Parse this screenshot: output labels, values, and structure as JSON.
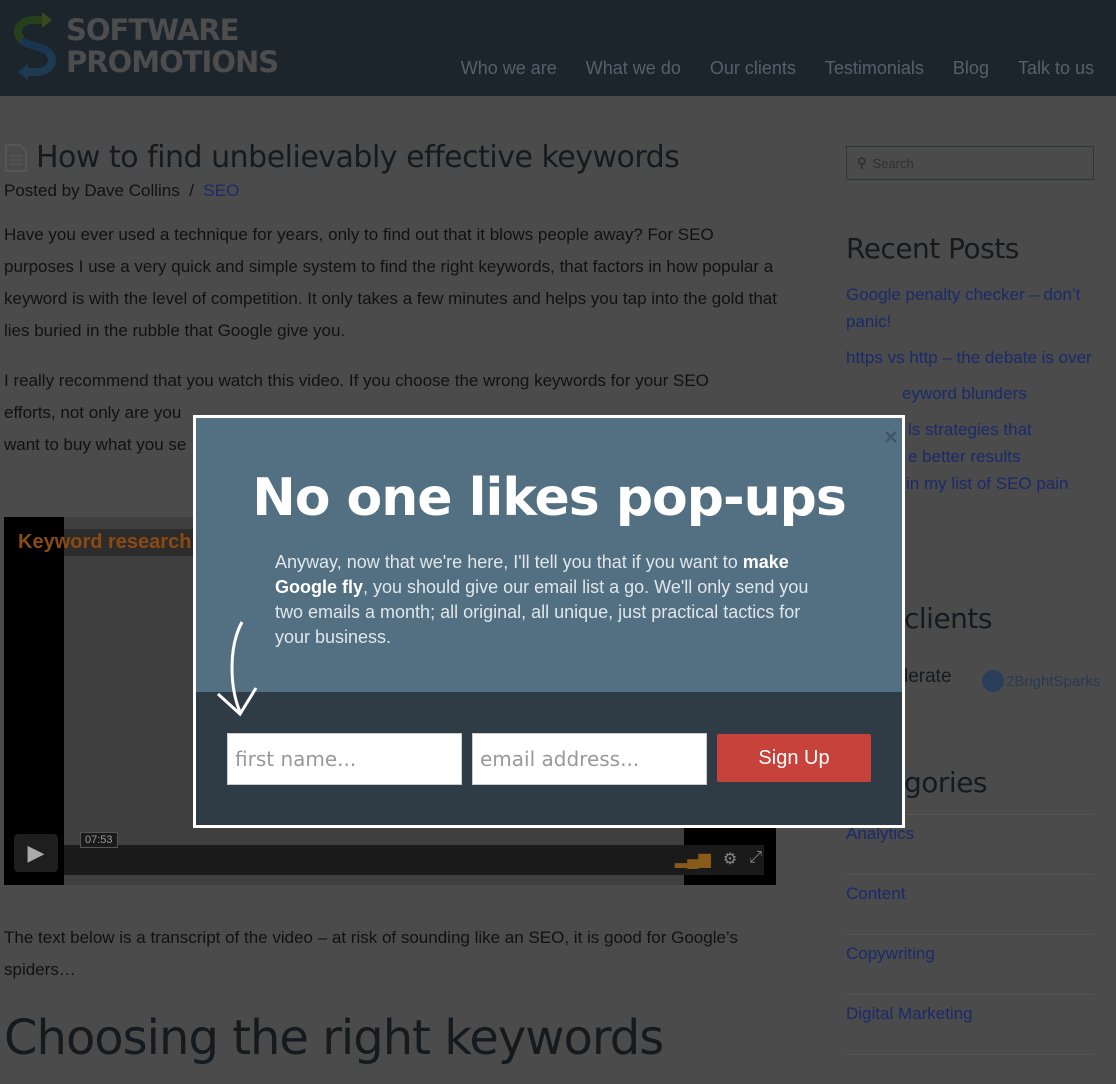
{
  "header": {
    "logo_line1": "SOFTWARE",
    "logo_line2": "PROMOTIONS",
    "nav": [
      "Who we are",
      "What we do",
      "Our clients",
      "Testimonials",
      "Blog",
      "Talk to us"
    ]
  },
  "post": {
    "title": "How to find unbelievably effective keywords",
    "posted_by": "Posted by Dave Collins",
    "separator": "/",
    "category": "SEO",
    "para1": "Have you ever used a technique for years, only to find out that it blows people away? For SEO purposes I use a very quick and simple system to find the right keywords, that factors in how popular a keyword is with the level of competition. It only takes a few minutes and helps you tap into the gold that lies buried  in the rubble that Google give you.",
    "para2_line1": "I really recommend that you watch this video. If you choose the wrong keywords for your SEO",
    "para2_line2": "efforts, not only are you",
    "para2_line3": "want to buy what you se",
    "video": {
      "title": "Keyword research",
      "time": "07:53"
    },
    "transcript": "The text below is a transcript of the video – at risk of sounding like an SEO, it is good for Google’s spiders…",
    "h2": "Choosing the right keywords"
  },
  "sidebar": {
    "search_placeholder": "Search",
    "recent_title": "Recent Posts",
    "recent": [
      "Google penalty checker – don’t panic!",
      "https vs http – the debate is over",
      "eyword blunders",
      "ls strategies that",
      "e better results",
      "in my list of SEO pain"
    ],
    "clients_title": "clients",
    "client_logos": [
      "lerate",
      "2BrightSparks"
    ],
    "categories_title": "gories",
    "categories": [
      "Analytics",
      "Content",
      "Copywriting",
      "Digital Marketing"
    ]
  },
  "popup": {
    "title": "No one likes pop-ups",
    "text_pre": "Anyway, now that we're here, I'll tell you that if you want to ",
    "text_bold": "make Google fly",
    "text_post": ", you should give our email list a go. We'll only send you two emails a month; all original, all unique, just practical tactics for your business.",
    "first_name_placeholder": "first name...",
    "email_placeholder": "email address...",
    "signup": "Sign Up",
    "close": "×"
  }
}
